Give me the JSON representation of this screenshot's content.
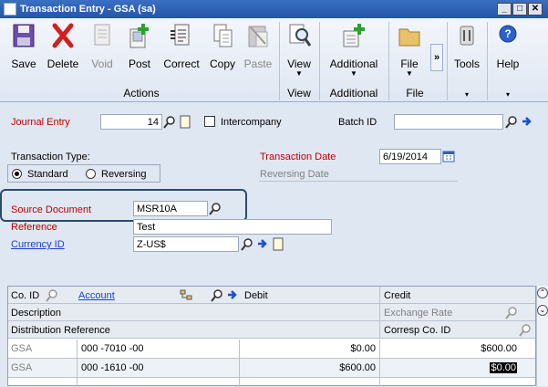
{
  "window": {
    "title": "Transaction Entry  -  GSA (sa)"
  },
  "ribbon": {
    "buttons": [
      {
        "label": "Save",
        "icon": "save-icon"
      },
      {
        "label": "Delete",
        "icon": "delete-icon"
      },
      {
        "label": "Void",
        "icon": "void-icon"
      },
      {
        "label": "Post",
        "icon": "post-icon"
      },
      {
        "label": "Correct",
        "icon": "correct-icon"
      },
      {
        "label": "Copy",
        "icon": "copy-icon"
      },
      {
        "label": "Paste",
        "icon": "paste-icon"
      },
      {
        "label": "View",
        "icon": "view-icon"
      },
      {
        "label": "Additional",
        "icon": "additional-icon"
      },
      {
        "label": "File",
        "icon": "folder-icon"
      },
      {
        "label": "Tools",
        "icon": "tools-icon"
      },
      {
        "label": "Help",
        "icon": "help-icon"
      }
    ],
    "groups": {
      "actions": "Actions",
      "view": "View",
      "additional": "Additional",
      "file": "File"
    },
    "overflow": "»"
  },
  "form": {
    "journal_entry_label": "Journal Entry",
    "journal_entry_value": "14",
    "intercompany_label": "Intercompany",
    "batch_id_label": "Batch ID",
    "batch_id_value": "",
    "transaction_type_label": "Transaction Type:",
    "standard_label": "Standard",
    "reversing_label": "Reversing",
    "transaction_date_label": "Transaction Date",
    "transaction_date_value": "6/19/2014",
    "reversing_date_label": "Reversing Date",
    "source_document_label": "Source Document",
    "source_document_value": "MSR10A",
    "reference_label": "Reference",
    "reference_value": "Test",
    "currency_id_label": "Currency ID",
    "currency_id_value": "Z-US$"
  },
  "grid": {
    "headers": {
      "co_id": "Co. ID",
      "account": "Account",
      "debit": "Debit",
      "credit": "Credit",
      "description": "Description",
      "exchange_rate": "Exchange Rate",
      "distribution_reference": "Distribution Reference",
      "corresp_co_id": "Corresp Co. ID"
    },
    "rows": [
      {
        "co_id": "GSA",
        "account": "000 -7010 -00",
        "debit": "$0.00",
        "credit": "$600.00"
      },
      {
        "co_id": "GSA",
        "account": "000 -1610 -00",
        "debit": "$600.00",
        "credit": "$0.00"
      }
    ]
  }
}
